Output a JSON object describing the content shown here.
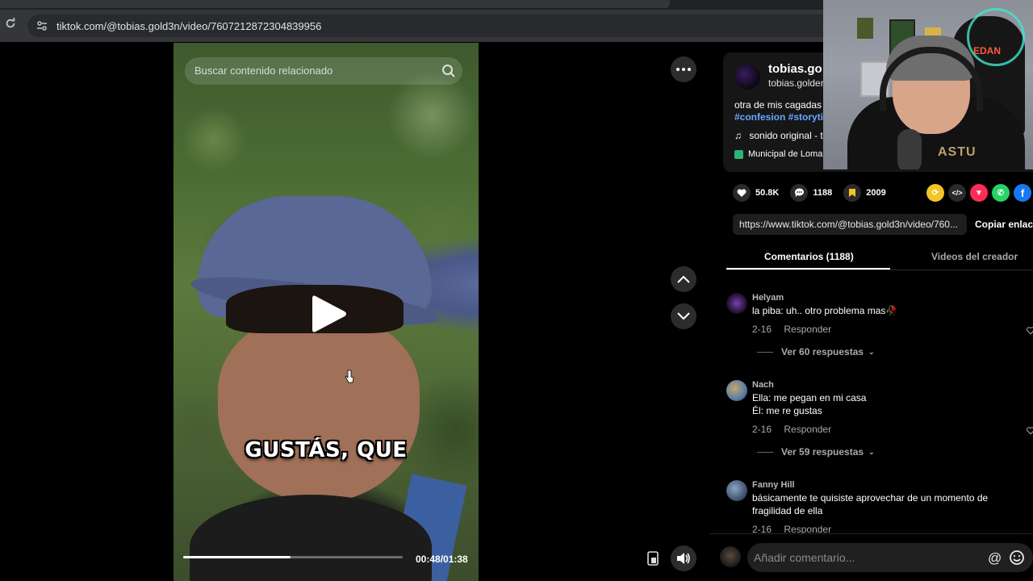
{
  "browser": {
    "url": "tiktok.com/@tobias.gold3n/video/7607212872304839956"
  },
  "video": {
    "search_placeholder": "Buscar contenido relacionado",
    "subtitle": "GUSTÁS, QUE",
    "time": "00:48/01:38",
    "progress": 0.49
  },
  "author": {
    "name": "tobias.go",
    "handle": "tobias.golder",
    "description": "otra de mis cagadas",
    "hashtags": "#confesion #storytir",
    "music": "sonido original - t",
    "location": "Municipal de Loma"
  },
  "stats": {
    "likes": "50.8K",
    "comments": "1188",
    "saves": "2009"
  },
  "share": {
    "icons": [
      "repost-icon",
      "embed-icon",
      "send-icon",
      "whatsapp-icon",
      "facebook-icon"
    ],
    "colors": [
      "#f2c524",
      "#2a2a2a",
      "#fe2c55",
      "#25d366",
      "#1877f2"
    ]
  },
  "link": {
    "url": "https://www.tiktok.com/@tobias.gold3n/video/760...",
    "copy_label": "Copiar enlace"
  },
  "tabs": {
    "comments": "Comentarios (1188)",
    "creator": "Videos del creador"
  },
  "comments": [
    {
      "user": "Helyam",
      "lines": [
        "la piba: uh.. otro problema mas🥀"
      ],
      "date": "2-16",
      "reply": "Responder",
      "replies": "Ver 60 respuestas"
    },
    {
      "user": "Nach",
      "lines": [
        "Ella: me pegan en mi casa",
        "Él: me re gustas"
      ],
      "date": "2-16",
      "reply": "Responder",
      "replies": "Ver 59 respuestas"
    },
    {
      "user": "Fanny Hill",
      "lines": [
        "básicamente te quisiste aprovechar de un momento de",
        "fragilidad de ella"
      ],
      "date": "2-16",
      "reply": "Responder"
    }
  ],
  "comment_bar": {
    "placeholder": "Añadir comentario...",
    "at": "@"
  },
  "webcam": {
    "neon_text": "EDAN",
    "shirt_text": "ASTU"
  },
  "colors": {
    "hashtag": "#64a8ff",
    "save_icon": "#f2c524",
    "location_icon": "#2bb673"
  }
}
